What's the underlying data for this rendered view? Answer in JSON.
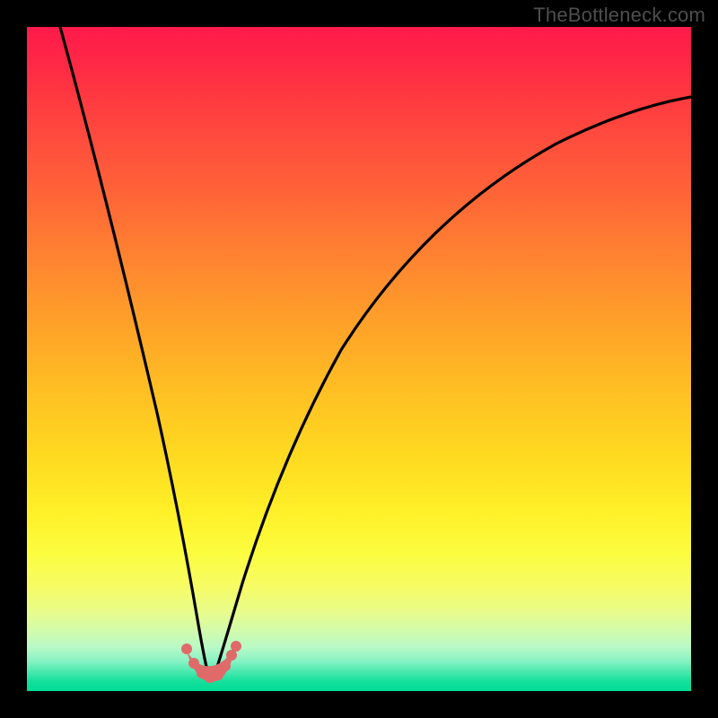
{
  "watermark": "TheBottleneck.com",
  "chart_data": {
    "type": "line",
    "title": "",
    "xlabel": "",
    "ylabel": "",
    "grid": false,
    "legend": false,
    "xlim": [
      0,
      100
    ],
    "ylim": [
      0,
      100
    ],
    "description": "Two black curves descending from the top into a V-shaped minimum near the bottom-left region against a red→yellow→green vertical gradient backdrop. Small pink/coral markers sit at the base of the V.",
    "series": [
      {
        "name": "left-curve",
        "color": "#000000",
        "x": [
          5,
          8,
          11,
          14,
          17,
          19,
          21,
          23,
          24,
          25,
          26,
          27
        ],
        "y": [
          100,
          86,
          72,
          58,
          44,
          33,
          23,
          13,
          8,
          5,
          3,
          2
        ]
      },
      {
        "name": "right-curve",
        "color": "#000000",
        "x": [
          28,
          30,
          32,
          35,
          39,
          44,
          50,
          57,
          65,
          74,
          84,
          95,
          100
        ],
        "y": [
          2,
          5,
          10,
          18,
          28,
          40,
          51,
          61,
          69,
          76,
          82,
          87,
          89
        ]
      },
      {
        "name": "valley-markers",
        "color": "#e06a6a",
        "type": "scatter",
        "x": [
          24,
          25,
          26,
          27,
          28,
          29,
          30,
          30.8
        ],
        "y": [
          6,
          4,
          3,
          2,
          2,
          3,
          5,
          7
        ]
      }
    ]
  }
}
